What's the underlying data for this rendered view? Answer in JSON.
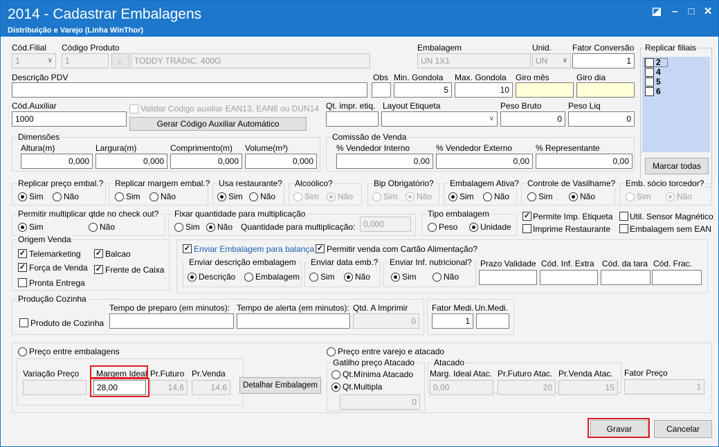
{
  "window": {
    "title": "2014 - Cadastrar Embalagens",
    "subtitle": "Distribuição e Varejo (Linha WinThor)",
    "btn_restore": "◪",
    "btn_min": "–",
    "btn_max": "□",
    "btn_close": "✕"
  },
  "r1": {
    "filial_label": "Cód.Filial",
    "filial_value": "1",
    "produto_label": "Código Produto",
    "produto_value": "1",
    "produto_desc": "TODDY TRADIC. 400G",
    "emb_label": "Embalagem",
    "emb_value": "UN 1X1",
    "unid_label": "Unid.",
    "unid_value": "UN",
    "fator_label": "Fator Conversão",
    "fator_value": "1"
  },
  "replicar": {
    "label": "Replicar filiais",
    "items": [
      "2",
      "4",
      "5",
      "6"
    ],
    "button": "Marcar todas"
  },
  "r2": {
    "desc_label": "Descrição PDV",
    "desc_value": "",
    "obs_label": "Obs",
    "obs_value": "",
    "min_label": "Min. Gondola",
    "min_value": "5",
    "max_label": "Max. Gondola",
    "max_value": "10",
    "giromes_label": "Giro mês",
    "giromes_value": "",
    "girodia_label": "Giro dia",
    "girodia_value": ""
  },
  "r3": {
    "aux_label": "Cód.Auxiliar",
    "aux_value": "1000",
    "validar_label": "Validar Código auxiliar EAN13, EAN8 ou DUN14",
    "gerar_btn": "Gerar Código Auxiliar Automático",
    "qt_label": "Qt. impr. etiq.",
    "qt_value": "",
    "layout_label": "Layout Etiqueta",
    "layout_value": "",
    "pbruto_label": "Peso Bruto",
    "pbruto_value": "0",
    "pliq_label": "Peso Liq",
    "pliq_value": "0"
  },
  "dim": {
    "title": "Dimensões",
    "alt_label": "Altura(m)",
    "alt_value": "0,000",
    "larg_label": "Largura(m)",
    "larg_value": "0,000",
    "comp_label": "Comprimento(m)",
    "comp_value": "0,000",
    "vol_label": "Volume(m³)",
    "vol_value": "0,000"
  },
  "com": {
    "title": "Comissão de Venda",
    "vi_label": "% Vendedor Interno",
    "vi_value": "0,00",
    "ve_label": "% Vendedor Externo",
    "ve_value": "0,00",
    "rep_label": "% Representante",
    "rep_value": "0,00"
  },
  "yn": {
    "sim": "Sim",
    "nao": "Não"
  },
  "g1": {
    "replicar_preco": "Replicar preço embal.?",
    "replicar_margem": "Replicar margem embal.?",
    "usa_rest": "Usa restaurante?",
    "alcoolico": "Alcoólico?",
    "bip": "Bip Obrigatório?",
    "emb_ativa": "Embalagem Ativa?",
    "vasilhame": "Controle de Vasilhame?",
    "socio": "Emb. sócio torcedor?"
  },
  "g2": {
    "permitir_mult": "Permitir multiplicar qtde no check out?",
    "fixar": "Fixar quantidade para multiplicação",
    "qtde_mult_label": "Quantidade para multiplicação:",
    "qtde_mult_value": "0,000",
    "tipo": "Tipo embalagem",
    "peso": "Peso",
    "unidade": "Unidade",
    "permite_imp": "Permite Imp. Etiqueta",
    "sensor": "Util. Sensor Magnético",
    "imprime_rest": "Imprime Restaurante",
    "sem_ean": "Embalagem sem EAN"
  },
  "origem": {
    "title": "Origem Venda",
    "tele": "Telemarketing",
    "balcao": "Balcao",
    "forca": "Força de Venda",
    "frente": "Frente de Caixa",
    "pronta": "Pronta Entrega"
  },
  "balanca": {
    "enviar": "Enviar Embalagem para balança",
    "cartao": "Permitir venda com Cartão Alimentação?",
    "desc_title": "Enviar descrição embalagem",
    "descricao": "Descrição",
    "embalagem": "Embalagem",
    "data_title": "Enviar data emb.?",
    "inf_title": "Enviar Inf. nutricional?",
    "prazo": "Prazo Validade",
    "cod_inf": "Cód. Inf. Extra",
    "cod_tara": "Cód. da tara",
    "cod_frac": "Cód. Frac."
  },
  "cozinha": {
    "title": "Produção Cozinha",
    "prod": "Produto de Cozinha",
    "tempo_prep": "Tempo de preparo (em minutos):",
    "tempo_alerta": "Tempo de alerta (em minutos):",
    "qtd_label": "Qtd. A Imprimir",
    "qtd_value": "0"
  },
  "fator": {
    "label": "Fator Medi.",
    "value": "1",
    "un_label": "Un.Medi.",
    "un_value": ""
  },
  "preco": {
    "entre_emb": "Preço entre embalagens",
    "variacao": "Variação Preço",
    "margem_ideal": "Margem Ideal",
    "margem_value": "28,00",
    "pr_futuro": "Pr.Futuro",
    "pr_futuro_value": "14,6",
    "pr_venda": "Pr.Venda",
    "pr_venda_value": "14,6",
    "detalhar": "Detalhar Embalagem",
    "entre_varejo": "Preço entre varejo e atacado",
    "gatilho": "Gatilho preço Atacado",
    "qt_min": "Qt.Mínima Atacado",
    "qt_mult": "Qt.Multipla",
    "gatilho_value": "0",
    "atacado": "Atacado",
    "marg_atac": "Marg. Ideal Atac.",
    "marg_atac_value": "0,00",
    "prf_atac": "Pr.Futuro Atac.",
    "prf_atac_value": "20",
    "prv_atac": "Pr.Venda Atac.",
    "prv_atac_value": "15",
    "fator_preco": "Fator Preço",
    "fator_preco_value": "1"
  },
  "footer": {
    "gravar": "Gravar",
    "cancelar": "Cancelar"
  },
  "colors": {
    "titlebar": "#1d77cb",
    "highlight": "#e21b24",
    "link": "#1a5fb4"
  }
}
